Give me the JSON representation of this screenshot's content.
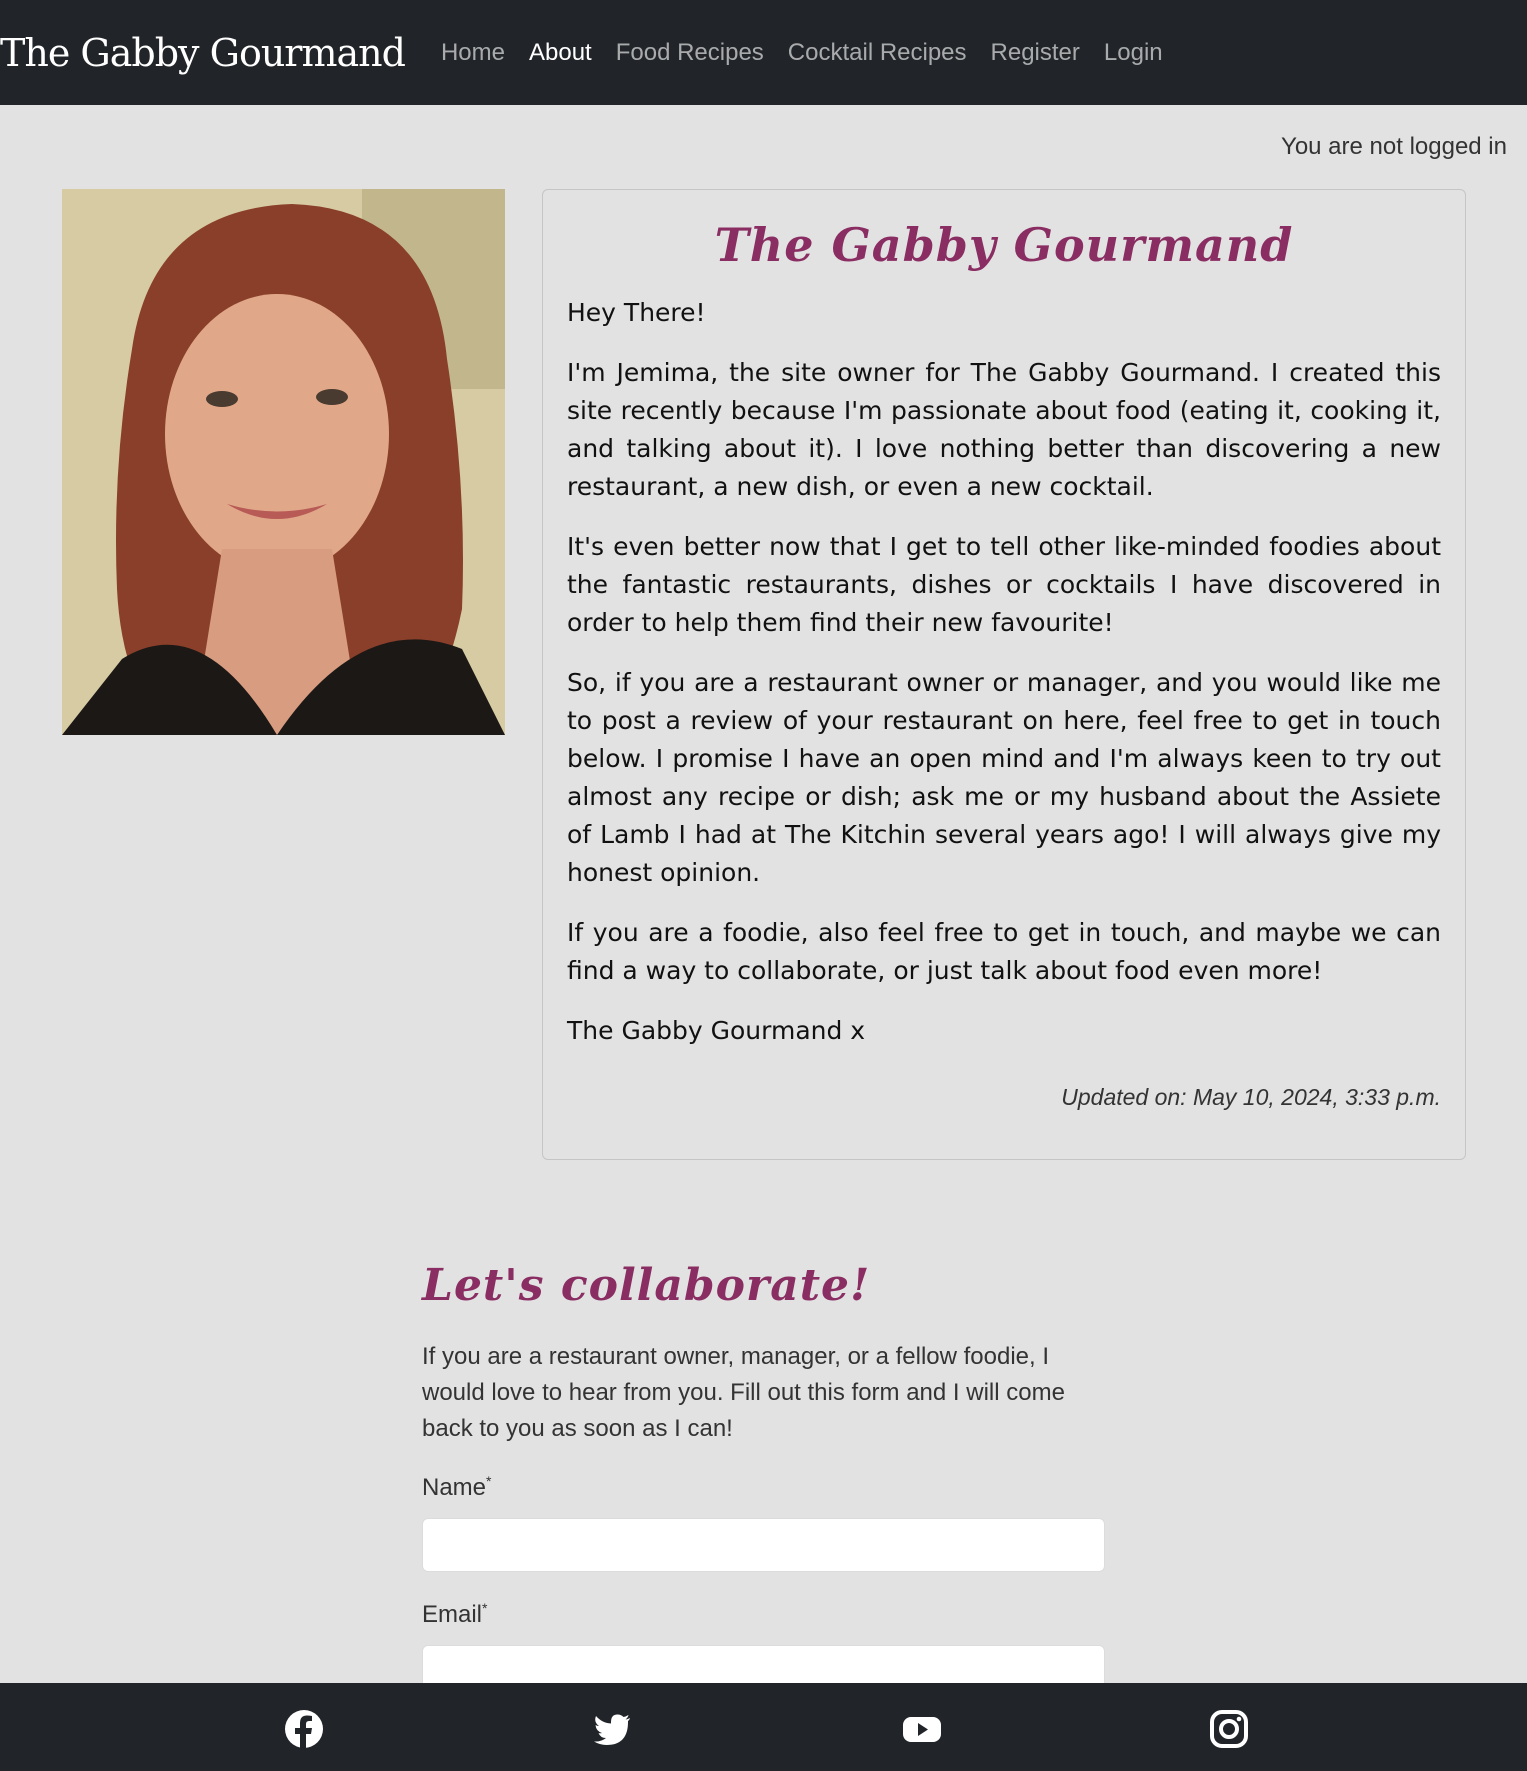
{
  "nav": {
    "brand": "The Gabby Gourmand",
    "links": [
      "Home",
      "About",
      "Food Recipes",
      "Cocktail Recipes",
      "Register",
      "Login"
    ],
    "active": "About"
  },
  "login_status": "You are not logged in",
  "about": {
    "title": "The Gabby Gourmand",
    "paragraphs": [
      "Hey There!",
      "I'm Jemima, the site owner for The Gabby Gourmand.  I created this site recently because I'm passionate about food (eating it, cooking it, and talking about it).  I love nothing better than discovering a new restaurant, a new dish, or even a new cocktail.",
      "It's even better now that I get to tell other like-minded foodies about the fantastic restaurants, dishes or cocktails I have discovered in order to help them find their new favourite!",
      "So, if you are a restaurant owner or manager, and you would like me to post a review of your restaurant on here, feel free to get in touch below.  I promise I have an open mind and I'm always keen to try out almost any recipe or dish; ask me or my husband about the Assiete of Lamb I had at The Kitchin several years ago!  I will always give my honest opinion.",
      "If you are a foodie, also feel free to get in touch, and maybe we can find a way to collaborate, or just talk about food even more!",
      "The Gabby Gourmand x"
    ],
    "updated": "Updated on: May 10, 2024, 3:33 p.m."
  },
  "collaborate": {
    "heading": "Let's collaborate!",
    "intro": "If you are a restaurant owner, manager, or a fellow foodie, I would love to hear from you. Fill out this form and I will come back to you as soon as I can!",
    "fields": [
      {
        "label": "Name",
        "required_mark": "*",
        "value": ""
      },
      {
        "label": "Email",
        "required_mark": "*",
        "value": ""
      }
    ]
  },
  "footer": {
    "social_icons": [
      "facebook-icon",
      "twitter-icon",
      "youtube-icon",
      "instagram-icon"
    ]
  },
  "colors": {
    "nav_bg": "#212529",
    "accent": "#8a2d62",
    "page_bg": "#e2e2e2"
  }
}
